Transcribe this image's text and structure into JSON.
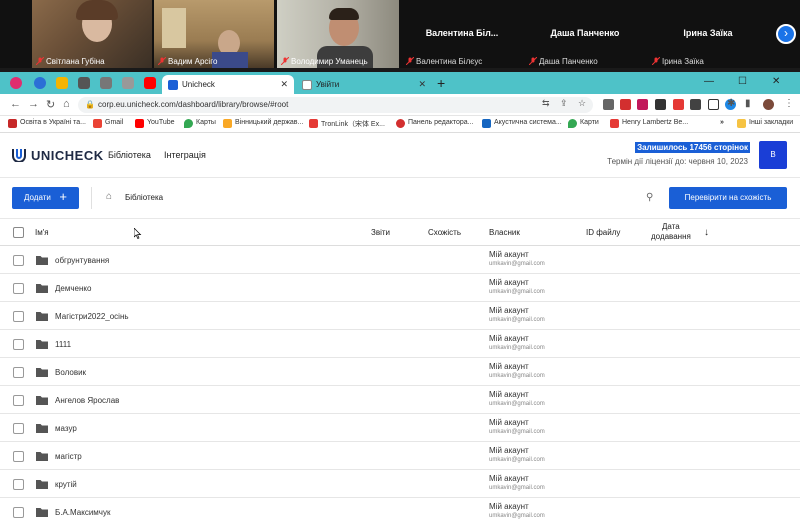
{
  "call": {
    "tiles": [
      {
        "name": "Світлана Губіна"
      },
      {
        "name": "Вадим Арсіго"
      },
      {
        "name": "Володимир Уманець"
      }
    ],
    "text_tiles": [
      {
        "big": "Валентина  Біл...",
        "name": "Валентина  Білєус"
      },
      {
        "big": "Даша Панченко",
        "name": "Даша Панченко"
      },
      {
        "big": "Ірина Заїка",
        "name": "Ірина Заїка"
      }
    ],
    "next_icon": "chevron-right-icon"
  },
  "browser": {
    "tabs": [
      {
        "label": "Unicheck",
        "active": true
      },
      {
        "label": "Увійти",
        "active": false
      }
    ],
    "url": "corp.eu.unicheck.com/dashboard/library/browse/#root",
    "bookmarks": [
      "Освіта в Україні та...",
      "Gmail",
      "YouTube",
      "Карты",
      "Вінницький держав...",
      "TronLink（宋体 Ex...",
      "Панель редактора...",
      "Акустична система...",
      "Карти",
      "Henry Lambertz Be...",
      "Інші закладки"
    ],
    "accent_color": "#4ec2c8"
  },
  "app": {
    "logo": "UNICHECK",
    "nav": [
      "Бібліотека",
      "Інтеграція"
    ],
    "quota": "Залишилось 17456 сторінок",
    "license": "Термін дії ліцензії до: червня 10, 2023",
    "avatar": "В",
    "add_label": "Додати",
    "breadcrumb": "Бібліотека",
    "check_label": "Перевірити на схожість",
    "columns": {
      "name": "Ім'я",
      "reports": "Звіти",
      "similarity": "Схожість",
      "owner": "Власник",
      "file_id": "ID файлу",
      "date_line1": "Дата",
      "date_line2": "додавання"
    },
    "rows": [
      {
        "name": "обгрунтування",
        "owner": "Мій акаунт",
        "email": "umkavin@gmail.com"
      },
      {
        "name": "Демченко",
        "owner": "Мій акаунт",
        "email": "umkavin@gmail.com"
      },
      {
        "name": "Магістри2022_осінь",
        "owner": "Мій акаунт",
        "email": "umkavin@gmail.com"
      },
      {
        "name": "1111",
        "owner": "Мій акаунт",
        "email": "umkavin@gmail.com"
      },
      {
        "name": "Воловик",
        "owner": "Мій акаунт",
        "email": "umkavin@gmail.com"
      },
      {
        "name": "Ангелов Ярослав",
        "owner": "Мій акаунт",
        "email": "umkavin@gmail.com"
      },
      {
        "name": "мазур",
        "owner": "Мій акаунт",
        "email": "umkavin@gmail.com"
      },
      {
        "name": "магістр",
        "owner": "Мій акаунт",
        "email": "umkavin@gmail.com"
      },
      {
        "name": "крутій",
        "owner": "Мій акаунт",
        "email": "umkavin@gmail.com"
      },
      {
        "name": "Б.А.Максимчук",
        "owner": "Мій акаунт",
        "email": "umkavin@gmail.com"
      }
    ],
    "primary_color": "#1a5fd6"
  }
}
